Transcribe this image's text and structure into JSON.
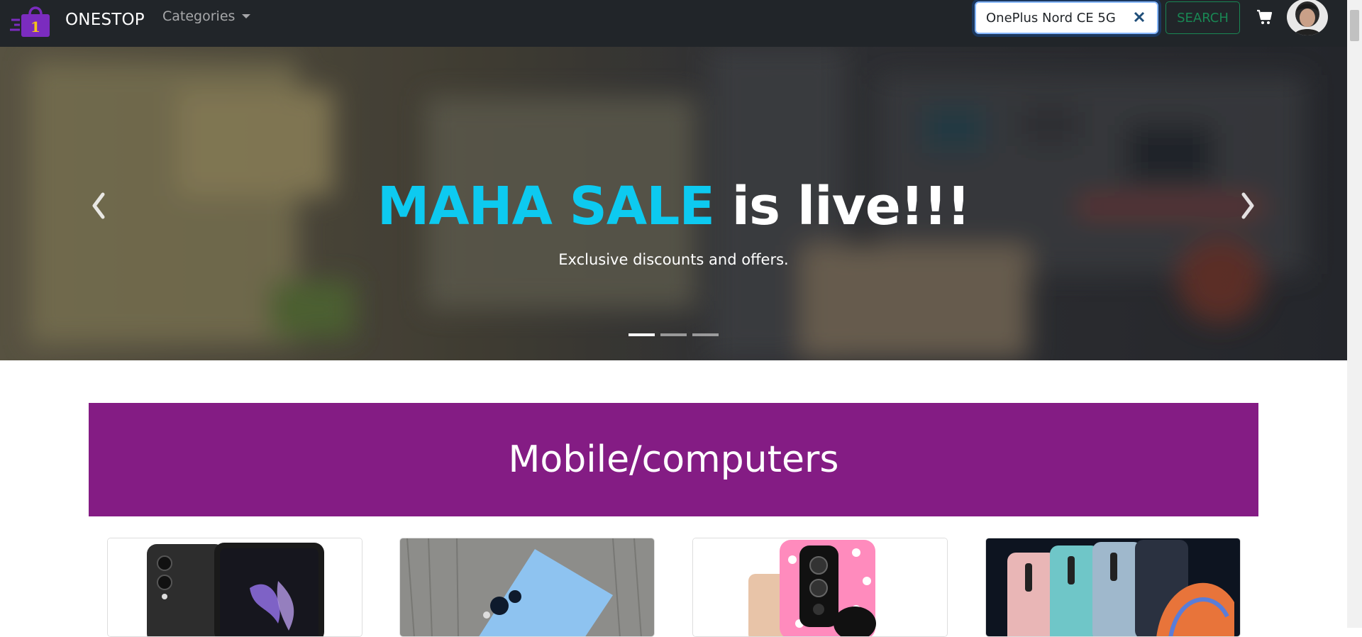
{
  "navbar": {
    "brand_name": "ONESTOP",
    "brand_logo_digit": "1",
    "categories_label": "Categories",
    "search_value": "OnePlus Nord CE 5G",
    "search_button_label": "SEARCH",
    "cart_icon": "cart-icon",
    "avatar": "user-avatar"
  },
  "hero": {
    "title_highlight": "MAHA SALE",
    "title_rest": " is live!!!",
    "subtitle": "Exclusive discounts and offers.",
    "active_slide": 1,
    "slide_count": 3
  },
  "section": {
    "title": "Mobile/computers"
  },
  "colors": {
    "navbar_bg": "#212529",
    "accent_cyan": "#0dcaf0",
    "banner_purple": "#841c84",
    "search_green": "#198754",
    "logo_purple": "#7b2cbf"
  },
  "products": [
    {
      "image": "phone-foldable-black"
    },
    {
      "image": "phone-blue-back"
    },
    {
      "image": "phone-case-minnie"
    },
    {
      "image": "phones-lineup"
    }
  ]
}
